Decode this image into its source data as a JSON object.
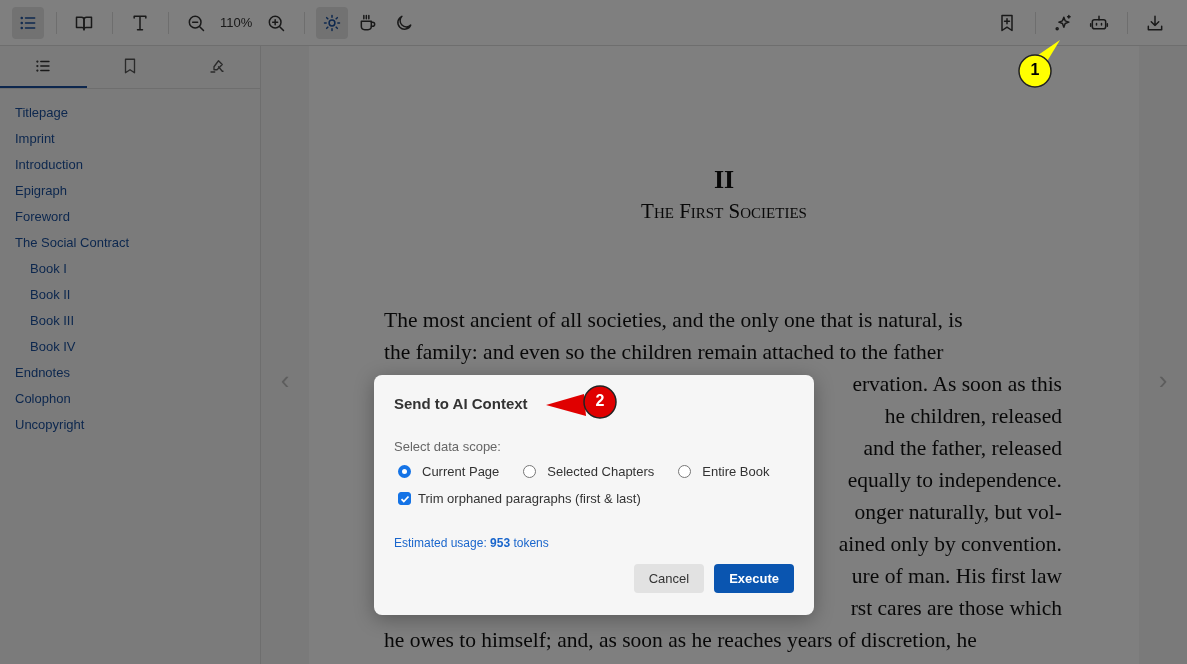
{
  "toolbar": {
    "toc_button": {
      "selected": true
    },
    "zoom_level": "110%",
    "themes": [
      {
        "selected": true
      },
      {
        "selected": false
      },
      {
        "selected": false
      }
    ]
  },
  "sidebar": {
    "tabs": [
      {
        "selected": true
      },
      {
        "selected": false
      },
      {
        "selected": false
      }
    ],
    "toc": [
      {
        "label": "Titlepage"
      },
      {
        "label": "Imprint"
      },
      {
        "label": "Introduction"
      },
      {
        "label": "Epigraph"
      },
      {
        "label": "Foreword"
      },
      {
        "label": "The Social Contract",
        "children": [
          {
            "label": "Book I"
          },
          {
            "label": "Book II"
          },
          {
            "label": "Book III"
          },
          {
            "label": "Book IV"
          }
        ]
      },
      {
        "label": "Endnotes"
      },
      {
        "label": "Colophon"
      },
      {
        "label": "Uncopyright"
      }
    ]
  },
  "book": {
    "chapter_number": "II",
    "chapter_title": "The First Societies",
    "lines": [
      {
        "text": "The most ancient of all societies, and the only one that is natural, is",
        "partial": false
      },
      {
        "text": "the family: and even so the children remain attached to the father",
        "partial": false
      },
      {
        "text": "ervation. As soon as this",
        "partial": true
      },
      {
        "text": "he children, released",
        "partial": true
      },
      {
        "text": "and the father, released",
        "partial": true
      },
      {
        "text": "equally to independence.",
        "partial": true
      },
      {
        "text": "onger naturally, but vol-",
        "partial": true
      },
      {
        "text": "ained only by convention.",
        "partial": true
      },
      {
        "text": "ure of man. His first law",
        "partial": true
      },
      {
        "text": "rst cares are those which",
        "partial": true
      },
      {
        "text": "he owes to himself; and, as soon as he reaches years of discretion, he",
        "partial": false
      }
    ],
    "prev": "‹",
    "next": "›"
  },
  "dialog": {
    "title": "Send to AI Context",
    "scope_label": "Select data scope:",
    "scope_options": [
      {
        "label": "Current Page",
        "selected": true
      },
      {
        "label": "Selected Chapters",
        "selected": false
      },
      {
        "label": "Entire Book",
        "selected": false
      }
    ],
    "trim": {
      "label": "Trim orphaned paragraphs (first & last)",
      "checked": true
    },
    "usage": "Estimated usage: **953** tokens",
    "buttons": [
      {
        "label": "Cancel",
        "kind": "secondary"
      },
      {
        "label": "Execute",
        "kind": "primary"
      }
    ]
  },
  "callouts": [
    {
      "label": "1",
      "color": "#ffff00"
    },
    {
      "label": "2",
      "color": "#e00000"
    }
  ]
}
